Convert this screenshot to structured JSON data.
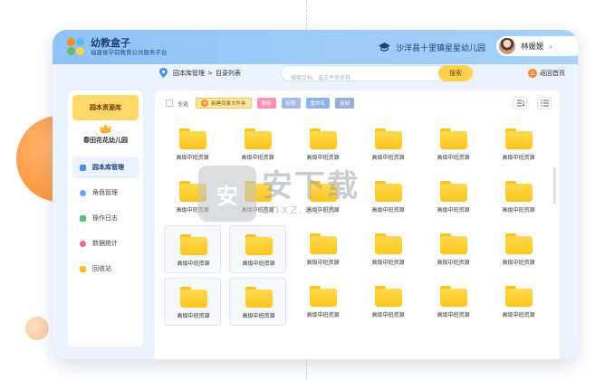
{
  "header": {
    "brand_title": "幼教盒子",
    "brand_subtitle": "福建省学前教育公共服务平台",
    "school_name": "沙洋县十里镇星星幼儿园",
    "user_name": "林媛媛",
    "user_arrow": "›"
  },
  "breadcrumb": {
    "part1": "园本库管理",
    "sep": ">",
    "part2": "目录列表"
  },
  "search": {
    "placeholder": "搜索文档、或文件夹名称",
    "button": "搜索"
  },
  "back": {
    "label": "返回首页"
  },
  "sidebar": {
    "header": "园本资源库",
    "kindergarten": "春田花花幼儿园",
    "items": [
      {
        "label": "园本库管理",
        "color": "#4a8ef0"
      },
      {
        "label": "角色管理",
        "color": "#6fa2f2"
      },
      {
        "label": "操作日志",
        "color": "#5bc07a"
      },
      {
        "label": "数据统计",
        "color": "#f06a8e"
      },
      {
        "label": "回收站",
        "color": "#ffbd2e"
      }
    ]
  },
  "toolbar": {
    "select_all": "全选",
    "new_folder": "新建目录文件夹",
    "delete": "删除",
    "permission": "权限",
    "rename": "重命名",
    "copy": "复制"
  },
  "files": [
    "高级中班资源",
    "高级中班资源",
    "高级中班资源",
    "高级中班资源",
    "高级中班资源",
    "高级中班资源",
    "高级中班资源",
    "高级中班资源",
    "高级中班资源",
    "高级中班资源",
    "高级中班资源",
    "高级中班资源",
    "高级中班资源",
    "高级中班资源",
    "高级中班资源",
    "高级中班资源",
    "高级中班资源",
    "高级中班资源",
    "高级中班资源",
    "高级中班资源",
    "高级中班资源",
    "高级中班资源",
    "高级中班资源",
    "高级中班资源"
  ],
  "watermark": {
    "cn": "安下载",
    "en": "anxz.com"
  },
  "colors": {
    "accent": "#ffd14f",
    "header": "#8fc3f5",
    "folder": "#ffc61f",
    "orange": "#ff8a2a"
  }
}
